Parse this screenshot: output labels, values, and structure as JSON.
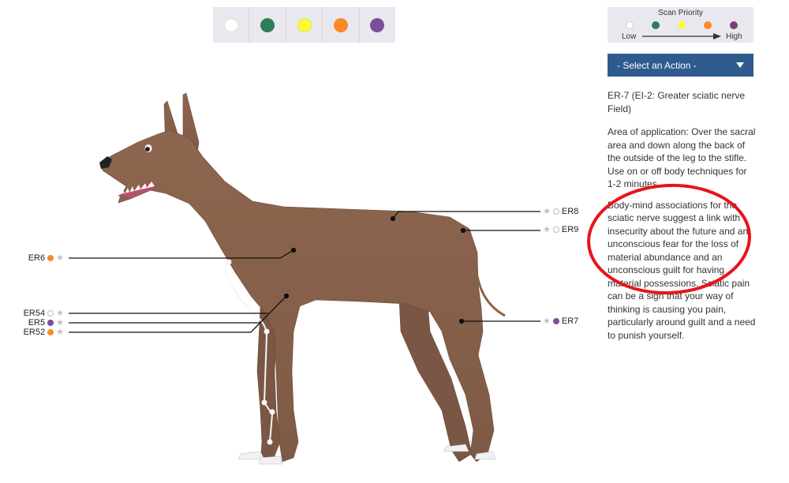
{
  "color_filters": [
    {
      "name": "white",
      "color": "#ffffff"
    },
    {
      "name": "green",
      "color": "#2e7d57"
    },
    {
      "name": "yellow",
      "color": "#fdf93a"
    },
    {
      "name": "orange",
      "color": "#fb8a26"
    },
    {
      "name": "purple",
      "color": "#7a4f9a"
    }
  ],
  "scan_priority": {
    "title": "Scan Priority",
    "low_label": "Low",
    "high_label": "High",
    "colors": [
      "#ffffff",
      "#2e7d57",
      "#fdf93a",
      "#fb8a26",
      "#7a3f7a"
    ]
  },
  "action_select": {
    "label": "- Select an Action -"
  },
  "info": {
    "title": "ER-7 (EI-2: Greater sciatic nerve Field)",
    "area": "Area of application: Over the sacral area and down along the back of the outside of the leg to the stifle. Use on or off body techniques for 1-2 minutes.",
    "body_mind": "Body-mind associations for the sciatic nerve suggest a link with insecurity about the future and an unconscious fear for the loss of material abundance and an unconscious guilt for having material possessions. Sciatic pain can be a sign that your way of thinking is causing you pain, particularly around guilt and a need to punish yourself."
  },
  "points_left": [
    {
      "id": "ER6",
      "label": "ER6",
      "color": "#fb8a26"
    },
    {
      "id": "ER54",
      "label": "ER54",
      "color": "#ffffff"
    },
    {
      "id": "ER5",
      "label": "ER5",
      "color": "#7a4f9a"
    },
    {
      "id": "ER52",
      "label": "ER52",
      "color": "#fb8a26"
    }
  ],
  "points_right": [
    {
      "id": "ER8",
      "label": "ER8",
      "color": "#ffffff"
    },
    {
      "id": "ER9",
      "label": "ER9",
      "color": "#ffffff"
    },
    {
      "id": "ER7",
      "label": "ER7",
      "color": "#7a4f9a"
    }
  ],
  "annotation_color": "#e8141b",
  "dog_color": "#8a6248"
}
